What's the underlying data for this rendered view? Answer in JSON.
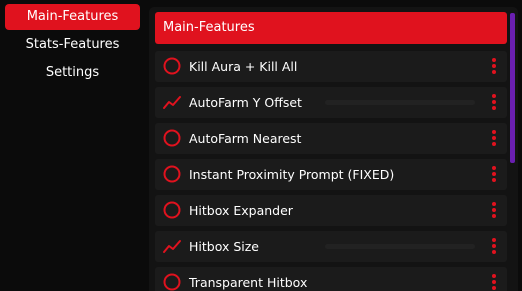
{
  "sidebar": {
    "items": [
      {
        "label": "Main-Features",
        "active": true
      },
      {
        "label": "Stats-Features",
        "active": false
      },
      {
        "label": "Settings",
        "active": false
      }
    ]
  },
  "main": {
    "section_title": "Main-Features",
    "features": [
      {
        "label": "Kill Aura + Kill All",
        "icon": "toggle-circle-icon",
        "kind": "toggle"
      },
      {
        "label": "AutoFarm Y Offset",
        "icon": "slider-graph-icon",
        "kind": "slider",
        "value": 0
      },
      {
        "label": "AutoFarm Nearest",
        "icon": "toggle-circle-icon",
        "kind": "toggle"
      },
      {
        "label": "Instant Proximity Prompt (FIXED)",
        "icon": "toggle-circle-icon",
        "kind": "toggle"
      },
      {
        "label": "Hitbox Expander",
        "icon": "toggle-circle-icon",
        "kind": "toggle"
      },
      {
        "label": "Hitbox Size",
        "icon": "slider-graph-icon",
        "kind": "slider",
        "value": 0
      },
      {
        "label": "Transparent Hitbox",
        "icon": "toggle-circle-icon",
        "kind": "toggle"
      }
    ]
  },
  "colors": {
    "accent": "#e0121e",
    "scrollbar": "#6a1fb1",
    "row_bg": "#1b1b1b",
    "panel_bg": "#131313",
    "window_bg": "#0b0b0b"
  }
}
